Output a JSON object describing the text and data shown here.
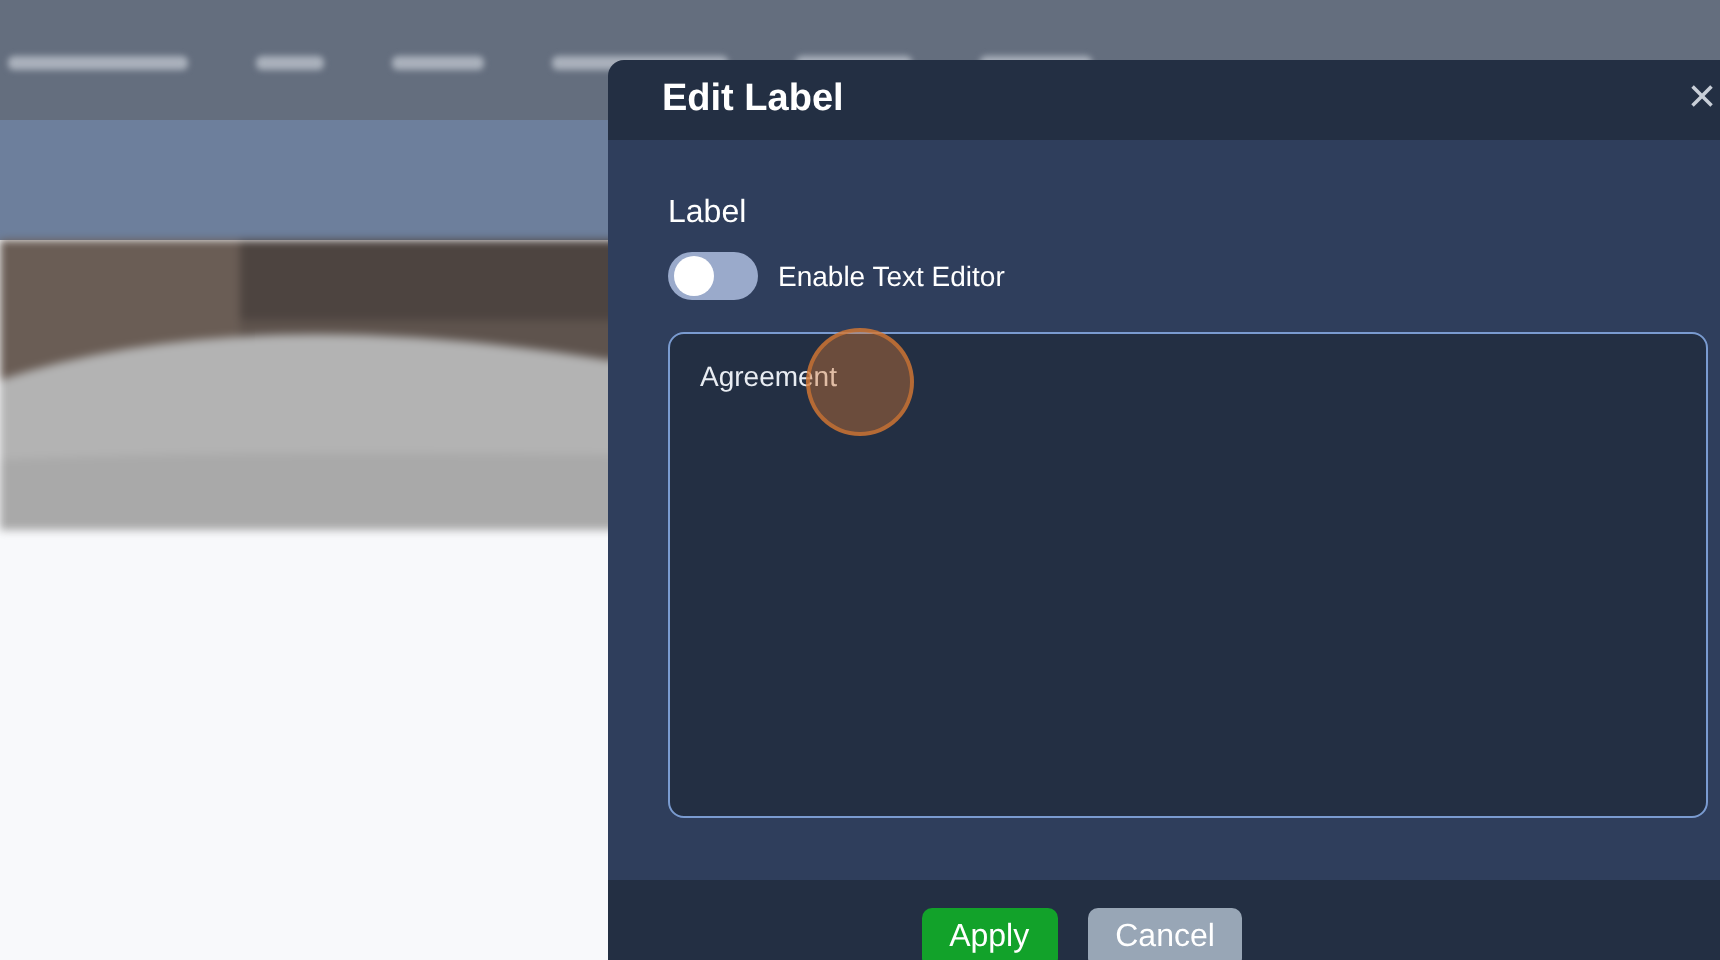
{
  "dialog": {
    "title": "Edit Label",
    "close": "×",
    "field_label": "Label",
    "toggle": {
      "label": "Enable Text Editor",
      "on": false
    },
    "text_value": "Agreement",
    "buttons": [
      {
        "label": "Apply",
        "kind": "primary"
      },
      {
        "label": "Cancel",
        "kind": "secondary"
      }
    ]
  }
}
